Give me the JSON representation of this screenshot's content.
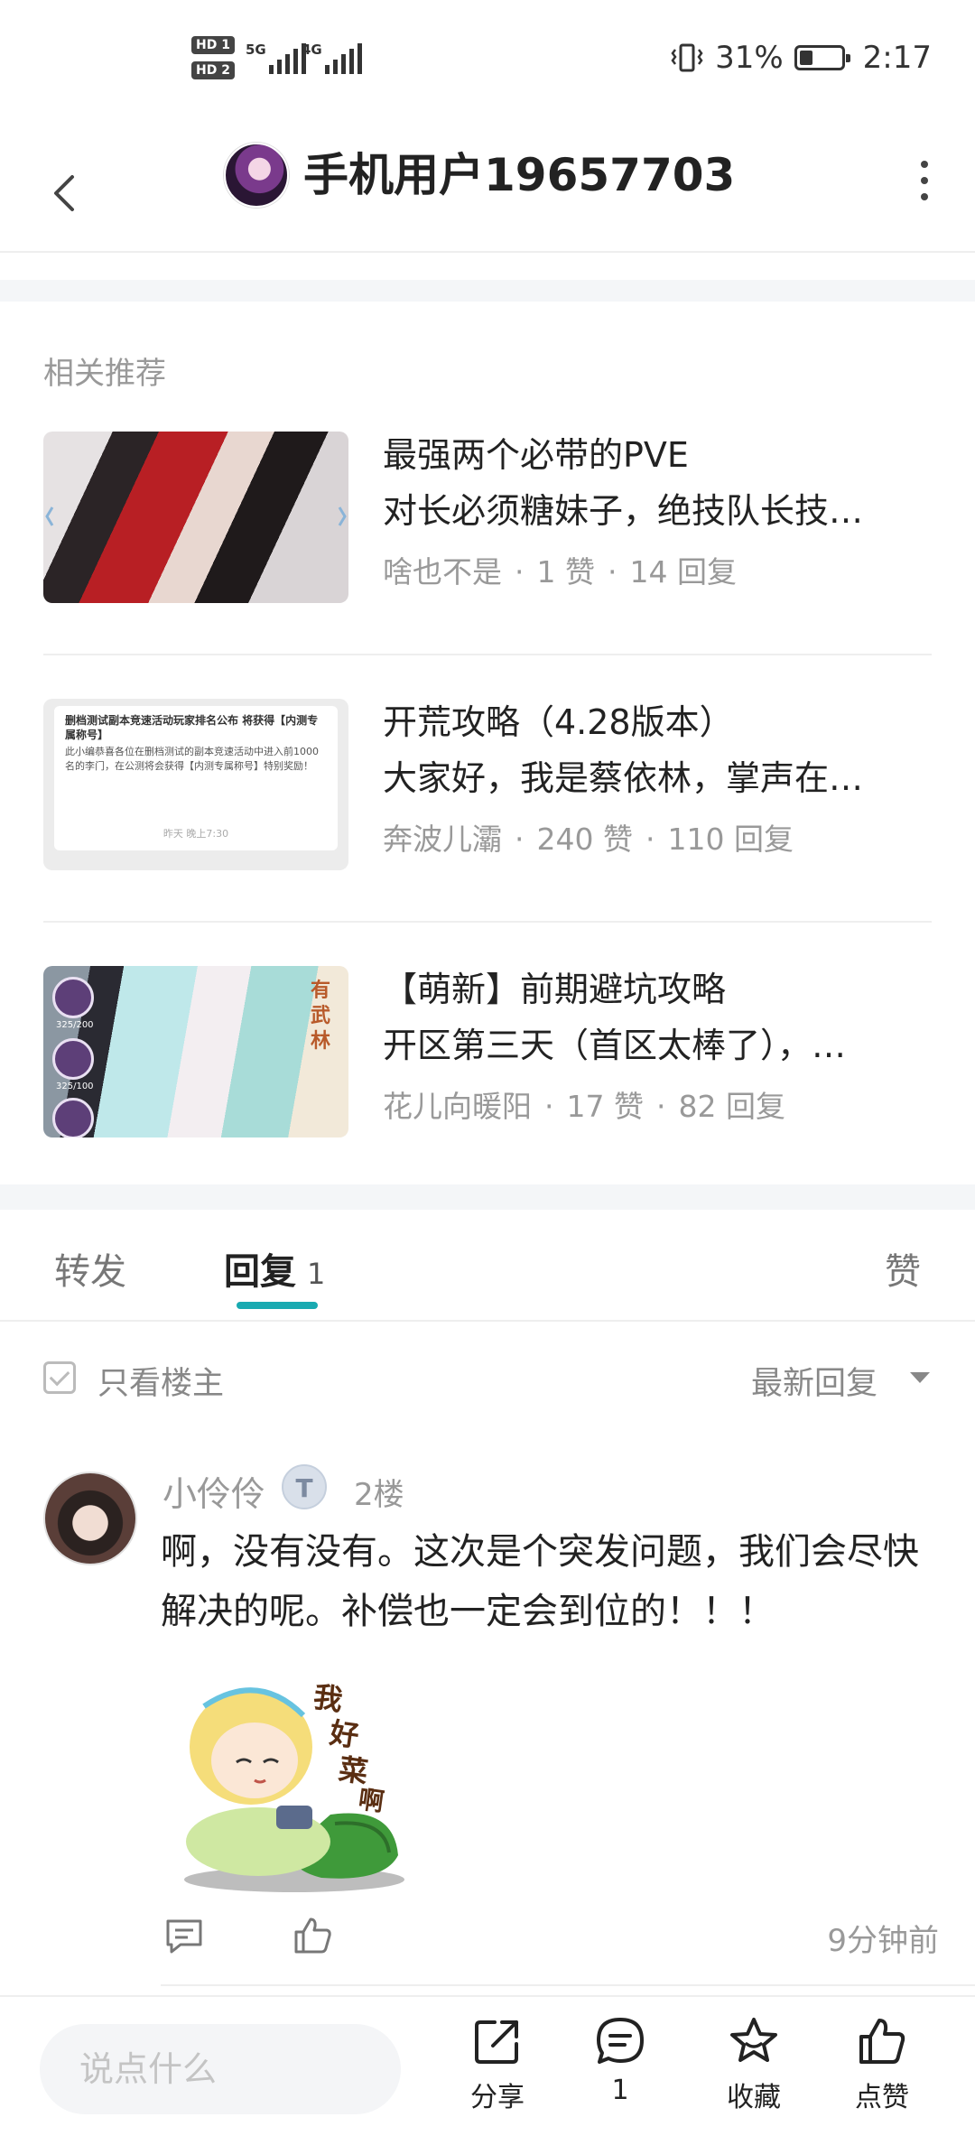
{
  "status_bar": {
    "hd1": "HD 1",
    "hd2": "HD 2",
    "net1": "5G",
    "net2": "4G",
    "battery_percent": "31%",
    "battery_level": 0.31,
    "time": "2:17"
  },
  "header": {
    "title": "手机用户19657703"
  },
  "related": {
    "label": "相关推荐",
    "items": [
      {
        "title": "最强两个必带的PVE",
        "excerpt": "对长必须糖妹子，绝技队长技…",
        "author": "啥也不是",
        "likes": "1 赞",
        "replies": "14 回复"
      },
      {
        "title": "开荒攻略（4.28版本）",
        "excerpt": "大家好，我是蔡依林，掌声在…",
        "author": "奔波儿灞",
        "likes": "240 赞",
        "replies": "110 回复"
      },
      {
        "title": "【萌新】前期避坑攻略",
        "excerpt": "开区第三天（首区太棒了），…",
        "author": "花儿向暖阳",
        "likes": "17 赞",
        "replies": "82 回复"
      }
    ],
    "thumb2_card": {
      "heading": "删档测试副本竞速活动玩家排名公布 将获得【内测专属称号】",
      "body": "此小编恭喜各位在删档测试的副本竞速活动中进入前1000名的李门，在公测将会获得【内测专属称号】特别奖励！",
      "footer": "昨天 晚上7:30"
    },
    "thumb3_labels": [
      "325/200",
      "325/100"
    ],
    "thumb3_stamp": "有武林"
  },
  "tabs": {
    "forward": "转发",
    "reply": "回复",
    "reply_count": "1",
    "like": "赞"
  },
  "filter": {
    "only_op": "只看楼主",
    "sort": "最新回复"
  },
  "comment": {
    "author": "小伶伶",
    "badge": "T",
    "floor": "2楼",
    "text": "啊，没有没有。这次是个突发问题，我们会尽快解决的呢。补偿也一定会到位的！！！",
    "sticker_text": "我好菜啊~",
    "time": "9分钟前"
  },
  "bottom_bar": {
    "input_placeholder": "说点什么",
    "share": "分享",
    "comments": "1",
    "favorite": "收藏",
    "like": "点赞"
  },
  "colors": {
    "accent": "#19aab1",
    "text_primary": "#222222",
    "text_muted": "#999999"
  }
}
